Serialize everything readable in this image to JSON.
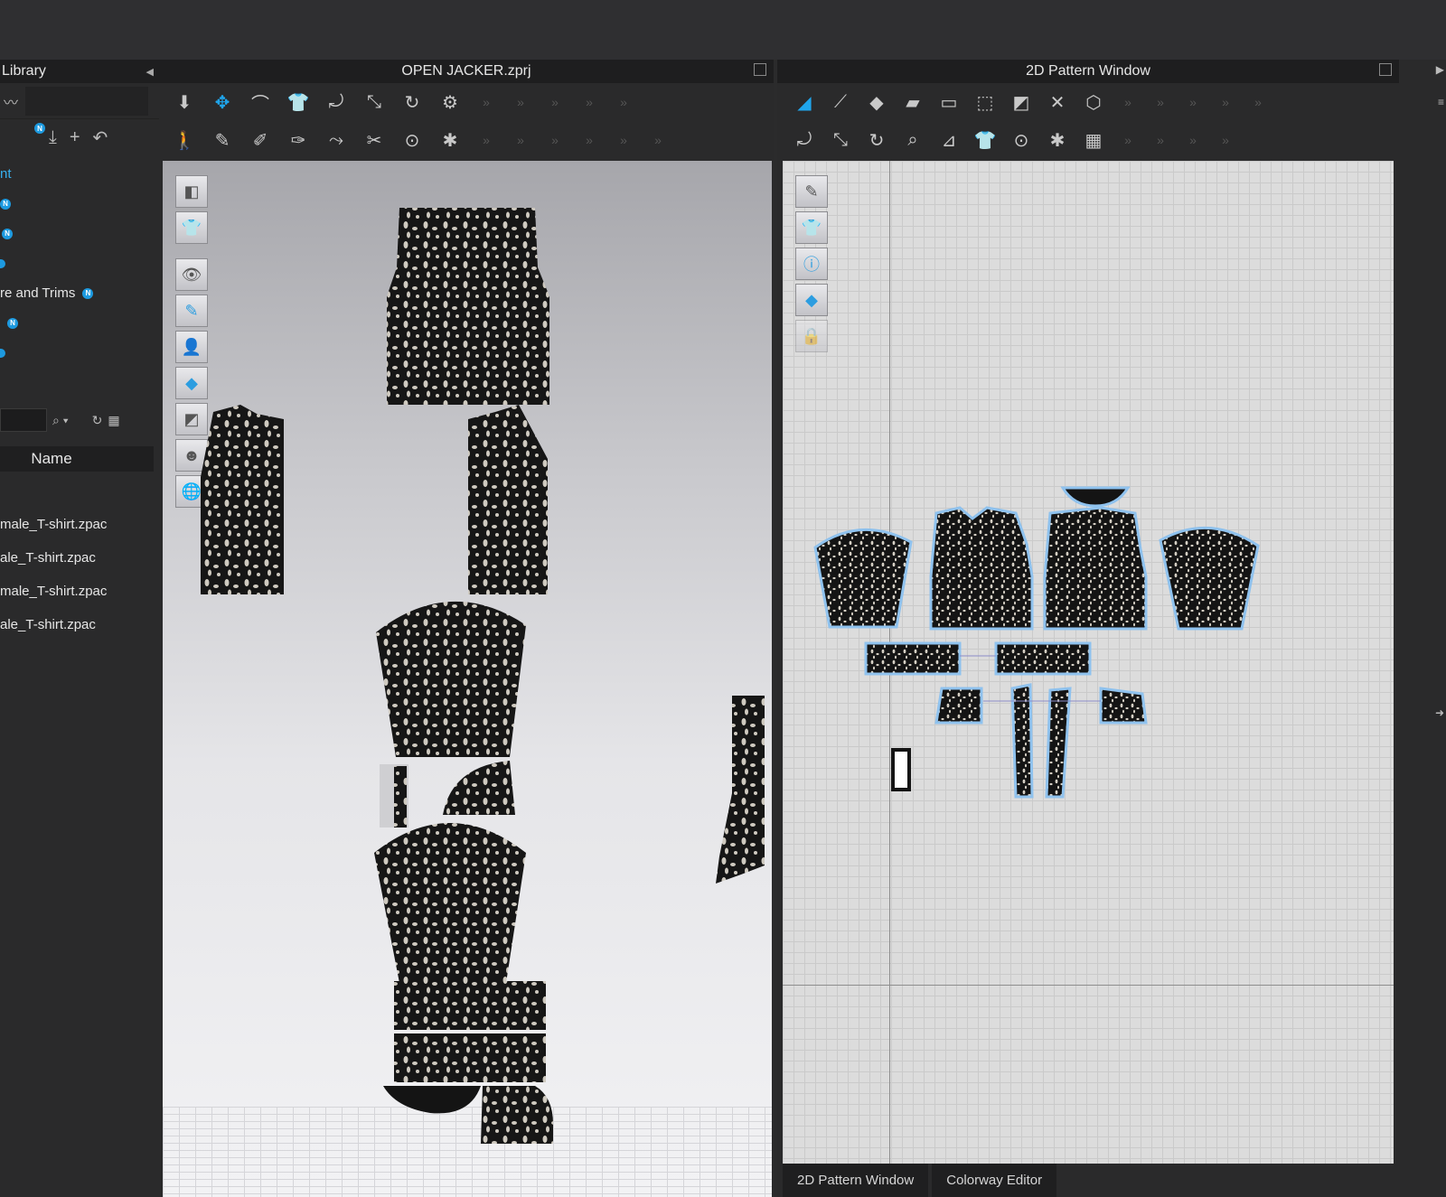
{
  "library": {
    "title": "Library",
    "tree": [
      {
        "label": "nt",
        "badge": ""
      },
      {
        "label": "",
        "badge": "N"
      },
      {
        "label": "",
        "badge": "N"
      },
      {
        "label": "",
        "badge": ""
      },
      {
        "label": "re and Trims",
        "badge": "N"
      },
      {
        "label": "",
        "badge": "N"
      },
      {
        "label": "",
        "badge": ""
      }
    ],
    "column_header": "Name",
    "files": [
      "male_T-shirt.zpac",
      "ale_T-shirt.zpac",
      "male_T-shirt.zpac",
      "ale_T-shirt.zpac"
    ]
  },
  "window3d": {
    "title": "OPEN JACKER.zprj"
  },
  "window2d": {
    "title": "2D Pattern Window"
  },
  "tabs": [
    "2D Pattern Window",
    "Colorway Editor"
  ],
  "colors": {
    "accent": "#1fa5ec",
    "fabric": "#151515",
    "selection": "#7fb9ea"
  }
}
